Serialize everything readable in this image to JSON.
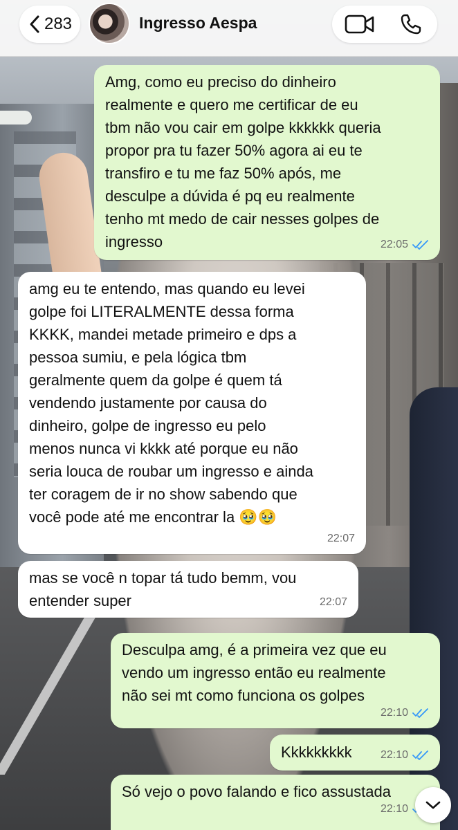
{
  "header": {
    "back_count": "283",
    "contact_name": "Ingresso Aespa"
  },
  "icons": {
    "back": "chevron-left-icon",
    "video": "video-camera-icon",
    "phone": "phone-icon",
    "ticks": "double-check-icon",
    "scroll": "chevron-down-icon"
  },
  "colors": {
    "outgoing_bubble": "#e2f8cf",
    "incoming_bubble": "#ffffff",
    "read_ticks": "#3497f9"
  },
  "messages": [
    {
      "direction": "out",
      "text": "Amg, como eu preciso do dinheiro\nrealmente e quero me certificar de eu\ntbm não vou cair em golpe kkkkkk queria\npropor pra tu fazer 50% agora ai eu te\ntransfiro e tu me faz 50% após, me\ndesculpe a dúvida é pq eu realmente\ntenho mt medo de cair nesses golpes de\ningresso",
      "time": "22:05"
    },
    {
      "direction": "in",
      "text": "amg eu te entendo, mas quando eu levei\ngolpe foi LITERALMENTE dessa forma\nKKKK, mandei metade primeiro e dps a\npessoa sumiu, e pela lógica tbm\ngeralmente quem da golpe é quem tá\nvendendo justamente por causa do\ndinheiro, golpe de ingresso eu pelo\nmenos nunca vi kkkk até porque eu não\nseria louca de roubar um ingresso e ainda\nter coragem de ir no show sabendo que\nvocê pode até me encontrar la 🥹🥹",
      "time": "22:07"
    },
    {
      "direction": "in",
      "text": "mas se você n topar tá tudo bemm, vou\nentender super",
      "time": "22:07"
    },
    {
      "direction": "out",
      "text": "Desculpa amg, é a primeira vez que eu\nvendo um ingresso então eu realmente\nnão sei mt como funciona os golpes",
      "time": "22:10"
    },
    {
      "direction": "out",
      "text": "Kkkkkkkkk",
      "time": "22:10"
    },
    {
      "direction": "out",
      "text": "Só vejo o povo falando e fico assustada",
      "time": "22:10"
    }
  ]
}
